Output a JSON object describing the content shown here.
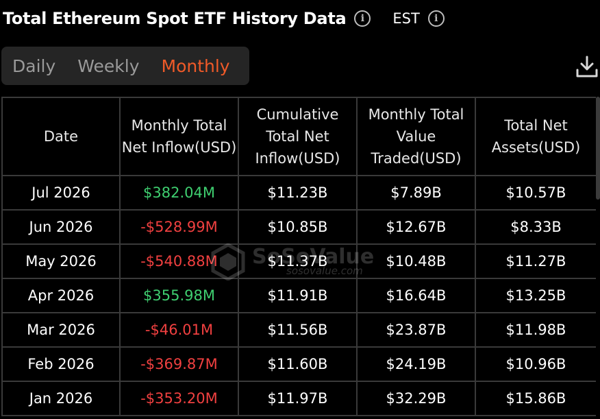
{
  "header": {
    "title": "Total Ethereum Spot ETF History Data",
    "timezone": "EST"
  },
  "tabs": [
    {
      "label": "Daily",
      "active": false
    },
    {
      "label": "Weekly",
      "active": false
    },
    {
      "label": "Monthly",
      "active": true
    }
  ],
  "colors": {
    "accent": "#f05a28",
    "positive": "#3fcf70",
    "negative": "#f04040"
  },
  "icons": {
    "info": "info-icon",
    "download": "download-icon"
  },
  "table": {
    "columns": [
      "Date",
      "Monthly Total Net Inflow(USD)",
      "Cumulative Total Net Inflow(USD)",
      "Monthly Total Value Traded(USD)",
      "Total Net Assets(USD)"
    ],
    "rows": [
      {
        "date": "Jul 2026",
        "inflow": "$382.04M",
        "sign": "pos",
        "cumulative": "$11.23B",
        "traded": "$7.89B",
        "assets": "$10.57B"
      },
      {
        "date": "Jun 2026",
        "inflow": "-$528.99M",
        "sign": "neg",
        "cumulative": "$10.85B",
        "traded": "$12.67B",
        "assets": "$8.33B"
      },
      {
        "date": "May 2026",
        "inflow": "-$540.88M",
        "sign": "neg",
        "cumulative": "$11.37B",
        "traded": "$10.48B",
        "assets": "$11.27B"
      },
      {
        "date": "Apr 2026",
        "inflow": "$355.98M",
        "sign": "pos",
        "cumulative": "$11.91B",
        "traded": "$16.64B",
        "assets": "$13.25B"
      },
      {
        "date": "Mar 2026",
        "inflow": "-$46.01M",
        "sign": "neg",
        "cumulative": "$11.56B",
        "traded": "$23.87B",
        "assets": "$11.98B"
      },
      {
        "date": "Feb 2026",
        "inflow": "-$369.87M",
        "sign": "neg",
        "cumulative": "$11.60B",
        "traded": "$24.19B",
        "assets": "$10.96B"
      },
      {
        "date": "Jan 2026",
        "inflow": "-$353.20M",
        "sign": "neg",
        "cumulative": "$11.97B",
        "traded": "$32.29B",
        "assets": "$15.86B"
      }
    ]
  },
  "watermark": {
    "brand": "SoSoValue",
    "site": "sosovalue.com"
  }
}
